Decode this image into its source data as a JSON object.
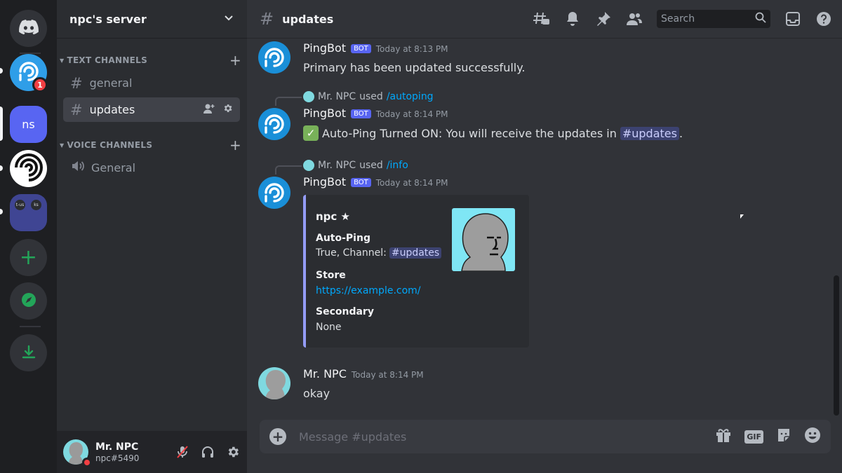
{
  "server_rail": {
    "items": [
      {
        "name": "home",
        "icon": "discord-logo-icon"
      },
      {
        "name": "pingbot-server",
        "icon": "ping-logo-icon",
        "mention_count": "1"
      },
      {
        "name": "npc-server",
        "label": "ns"
      },
      {
        "name": "swirl-server",
        "icon": "swirl-icon"
      },
      {
        "name": "server-folder",
        "labels": [
          "t-us",
          "ks"
        ]
      },
      {
        "name": "add-server",
        "icon": "plus-icon"
      },
      {
        "name": "explore",
        "icon": "compass-icon"
      },
      {
        "name": "download",
        "icon": "download-icon"
      }
    ]
  },
  "sidebar": {
    "server_name": "npc's server",
    "categories": [
      {
        "label": "TEXT CHANNELS"
      },
      {
        "label": "VOICE CHANNELS"
      }
    ],
    "channels": [
      {
        "label": "general"
      },
      {
        "label": "updates"
      },
      {
        "label": "General"
      }
    ]
  },
  "user_panel": {
    "display_name": "Mr. NPC",
    "tag": "npc#5490",
    "status": "dnd"
  },
  "topbar": {
    "channel": "updates",
    "search_placeholder": "Search"
  },
  "messages": [
    {
      "author": "PingBot",
      "bot_badge": "BOT",
      "time": "Today at 8:13 PM",
      "text": "Primary has been updated successfully."
    },
    {
      "reply_user": "Mr. NPC",
      "reply_used": "used",
      "reply_command": "/autoping",
      "author": "PingBot",
      "bot_badge": "BOT",
      "time": "Today at 8:14 PM",
      "text": "Auto-Ping Turned ON: You will receive the updates in",
      "mention": "#updates",
      "suffix": "."
    },
    {
      "reply_user": "Mr. NPC",
      "reply_used": "used",
      "reply_command": "/info",
      "author": "PingBot",
      "bot_badge": "BOT",
      "time": "Today at 8:14 PM",
      "embed": {
        "title": "npc ★",
        "fields": [
          {
            "name": "Auto-Ping",
            "value": "True, Channel:",
            "mention": "#updates"
          },
          {
            "name": "Store",
            "value": "https://example.com/"
          },
          {
            "name": "Secondary",
            "value": "None"
          }
        ],
        "accent": "#949cf7"
      }
    },
    {
      "author": "Mr. NPC",
      "time": "Today at 8:14 PM",
      "text": "okay"
    }
  ],
  "composer": {
    "placeholder": "Message #updates",
    "gif_label": "GIF"
  },
  "colors": {
    "accent": "#5865f2",
    "link": "#00a8fc",
    "dnd": "#f23f43",
    "online_green": "#23a559"
  }
}
